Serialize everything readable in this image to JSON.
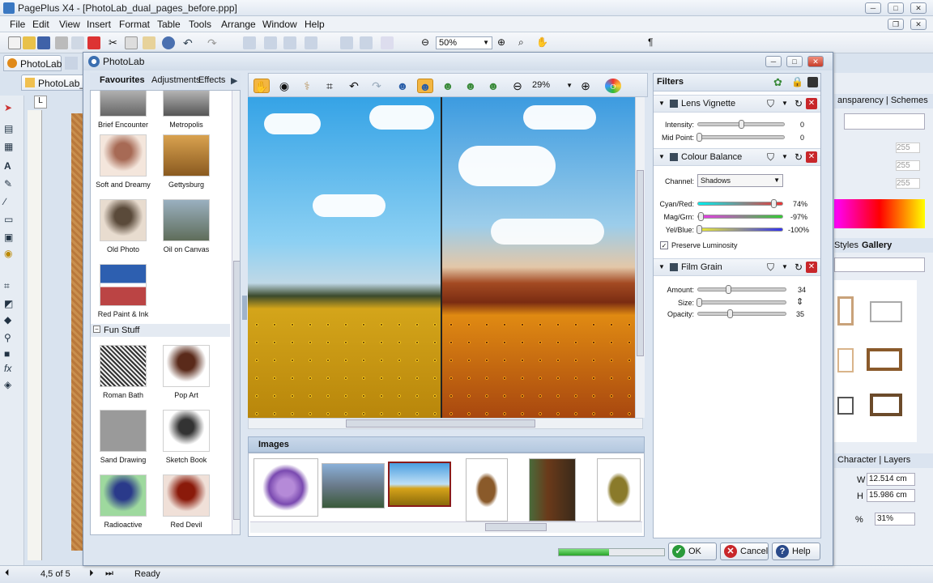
{
  "app": {
    "title": "PagePlus X4 - [PhotoLab_dual_pages_before.ppp]"
  },
  "menu": [
    "File",
    "Edit",
    "View",
    "Insert",
    "Format",
    "Table",
    "Tools",
    "Arrange",
    "Window",
    "Help"
  ],
  "toolbar": {
    "zoom": "50%"
  },
  "doc_tabs": [
    "PhotoLab",
    "PhotoLab_"
  ],
  "right_panel": {
    "tabs_top": "ansparency | Schemes",
    "tabs_mid": [
      "Styles",
      "Gallery"
    ],
    "rgb_values": [
      "255",
      "255",
      "255"
    ],
    "char_tabs": "Character | Layers",
    "w_value": "12.514 cm",
    "h_value": "15.986 cm",
    "w_label": "W",
    "h_label": "H",
    "pct_value": "31%",
    "pct_label": "%"
  },
  "status": {
    "page": "4,5 of 5",
    "text": "Ready"
  },
  "photolab": {
    "title": "PhotoLab",
    "tabs": [
      "Favourites",
      "Adjustments",
      "Effects"
    ],
    "favourites": [
      {
        "label": "Brief Encounter"
      },
      {
        "label": "Metropolis"
      },
      {
        "label": "Soft and Dreamy"
      },
      {
        "label": "Gettysburg"
      },
      {
        "label": "Old Photo"
      },
      {
        "label": "Oil on Canvas"
      },
      {
        "label": "Red Paint & Ink"
      }
    ],
    "group_fun": "Fun Stuff",
    "fun": [
      {
        "label": "Roman Bath"
      },
      {
        "label": "Pop Art"
      },
      {
        "label": "Sand Drawing"
      },
      {
        "label": "Sketch Book"
      },
      {
        "label": "Radioactive"
      },
      {
        "label": "Red Devil"
      }
    ],
    "zoom": "29%",
    "images_header": "Images",
    "filters_header": "Filters",
    "filters": [
      {
        "name": "Lens Vignette",
        "params": [
          {
            "label": "Intensity:",
            "value": "0"
          },
          {
            "label": "Mid Point:",
            "value": "0"
          }
        ]
      },
      {
        "name": "Colour Balance",
        "channel_label": "Channel:",
        "channel": "Shadows",
        "params": [
          {
            "label": "Cyan/Red:",
            "value": "74%"
          },
          {
            "label": "Mag/Grn:",
            "value": "-97%"
          },
          {
            "label": "Yel/Blue:",
            "value": "-100%"
          }
        ],
        "preserve": "Preserve Luminosity"
      },
      {
        "name": "Film Grain",
        "params": [
          {
            "label": "Amount:",
            "value": "34"
          },
          {
            "label": "Size:",
            "value": ""
          },
          {
            "label": "Opacity:",
            "value": "35"
          }
        ]
      }
    ],
    "buttons": {
      "ok": "OK",
      "cancel": "Cancel",
      "help": "Help"
    },
    "progress": 0.48
  },
  "colors": {
    "accent": "#3b6fb0",
    "close": "#c8262a",
    "progress": "#2aa52a"
  }
}
